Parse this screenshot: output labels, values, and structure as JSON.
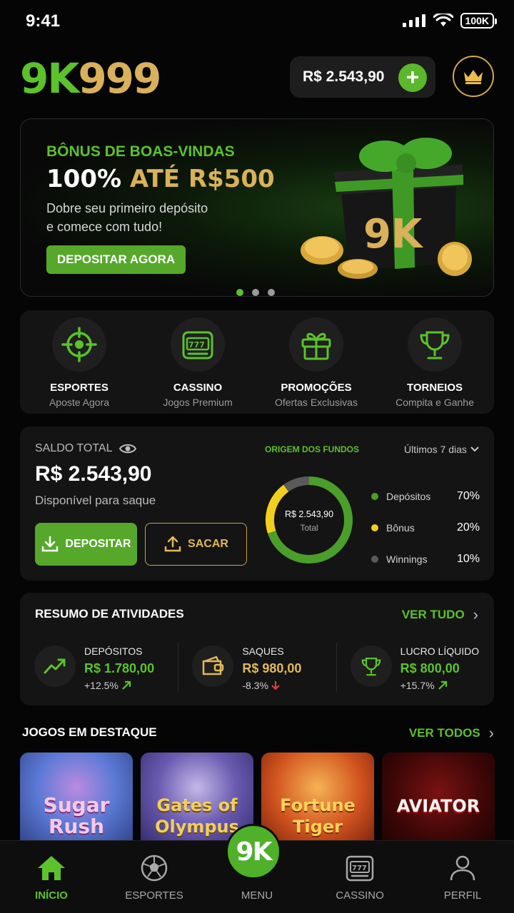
{
  "status": {
    "time": "9:41",
    "battery": "100K"
  },
  "header": {
    "logo_a": "9K",
    "logo_b": "999",
    "balance": "R$ 2.543,90",
    "add_label": "+"
  },
  "banner": {
    "eyebrow": "BÔNUS DE BOAS-VINDAS",
    "title_a": "100%",
    "title_b": "ATÉ R$500",
    "line1": "Dobre seu primeiro depósito",
    "line2": "e comece com tudo!",
    "cta": "DEPOSITAR AGORA",
    "gift_label": "9K"
  },
  "categories": [
    {
      "label": "ESPORTES",
      "sub": "Aposte Agora",
      "icon": "target-icon"
    },
    {
      "label": "CASSINO",
      "sub": "Jogos Premium",
      "icon": "slot-machine-icon"
    },
    {
      "label": "PROMOÇÕES",
      "sub": "Ofertas Exclusivas",
      "icon": "gift-icon"
    },
    {
      "label": "TORNEIOS",
      "sub": "Compita e Ganhe",
      "icon": "trophy-icon"
    }
  ],
  "wallet": {
    "label": "SALDO TOTAL",
    "amount": "R$ 2.543,90",
    "available": "Disponível para saque",
    "deposit": "DEPOSITAR",
    "withdraw": "SACAR",
    "origin_title": "ORIGEM DOS FUNDOS",
    "period": "Últimos 7 dias",
    "donut_amount": "R$ 2.543,90",
    "donut_caption": "Total",
    "legend": [
      {
        "name": "Depósitos",
        "pct": "70%",
        "value": 70,
        "color": "#4a9e2a"
      },
      {
        "name": "Bônus",
        "pct": "20%",
        "value": 20,
        "color": "#f2cf1d"
      },
      {
        "name": "Winnings",
        "pct": "10%",
        "value": 10,
        "color": "#5a5a5a"
      }
    ]
  },
  "activity": {
    "title": "RESUMO DE ATIVIDADES",
    "see_all": "VER TUDO",
    "items": [
      {
        "label": "DEPÓSITOS",
        "value": "R$ 1.780,00",
        "delta": "+12.5%"
      },
      {
        "label": "SAQUES",
        "value": "R$ 980,00",
        "delta": "-8.3%"
      },
      {
        "label": "LUCRO LÍQUIDO",
        "value": "R$ 800,00",
        "delta": "+15.7%"
      }
    ]
  },
  "games": {
    "title": "JOGOS EM DESTAQUE",
    "see_all": "VER TODOS",
    "items": [
      {
        "name_a": "Sugar",
        "name_b": "Rush"
      },
      {
        "name_a": "Gates of",
        "name_b": "Olympus"
      },
      {
        "name_a": "Fortune",
        "name_b": "Tiger"
      },
      {
        "name_a": "AVIATOR",
        "name_b": ""
      }
    ]
  },
  "nav": {
    "items": [
      {
        "label": "INÍCIO"
      },
      {
        "label": "ESPORTES"
      },
      {
        "label": "MENU"
      },
      {
        "label": "CASSINO"
      },
      {
        "label": "PERFIL"
      }
    ],
    "center": "9K"
  }
}
